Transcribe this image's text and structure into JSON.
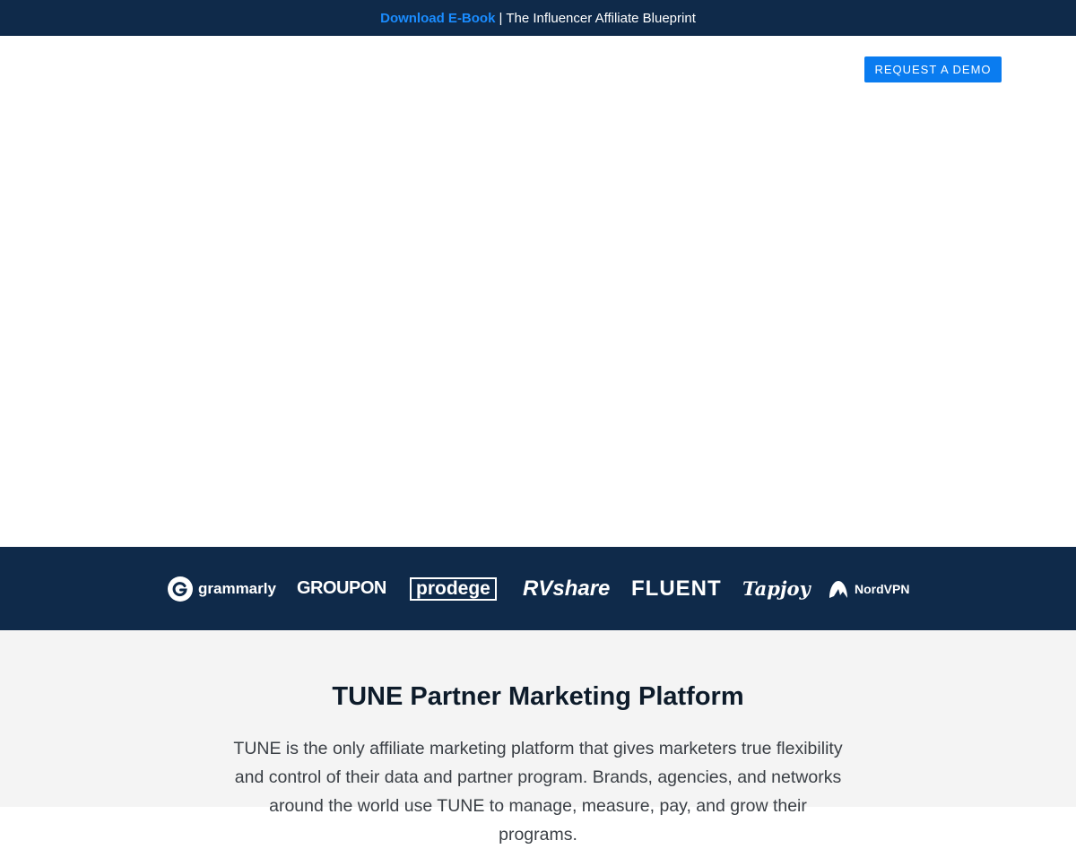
{
  "promo": {
    "link_text": "Download E-Book",
    "separator": "|",
    "message": "The Influencer Affiliate Blueprint"
  },
  "header": {
    "demo_button": "REQUEST A DEMO"
  },
  "logos": [
    {
      "name": "grammarly",
      "text": "grammarly"
    },
    {
      "name": "groupon",
      "text": "GROUPON"
    },
    {
      "name": "prodege",
      "text": "prodege"
    },
    {
      "name": "rvshare",
      "text": "RVshare"
    },
    {
      "name": "fluent",
      "text": "FLUENT"
    },
    {
      "name": "tapjoy",
      "text": "Tapjoy"
    },
    {
      "name": "nordvpn",
      "text": "NordVPN"
    }
  ],
  "platform": {
    "title": "TUNE Partner Marketing Platform",
    "description": "TUNE is the only affiliate marketing platform that gives marketers true flexibility and control of their data and partner program. Brands, agencies, and networks around the world use TUNE to manage, measure, pay, and grow their programs."
  },
  "colors": {
    "navy": "#0f2a4a",
    "accent_blue": "#0a7cf0",
    "link_blue": "#1a8cff",
    "section_gray": "#f4f4f4"
  }
}
